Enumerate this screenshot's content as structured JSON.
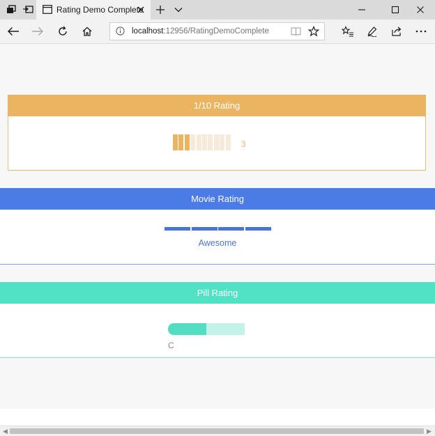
{
  "browser": {
    "tab_title": "Rating Demo Complete",
    "url_host": "localhost",
    "url_path": ":12956/RatingDemoComplete"
  },
  "panels": {
    "ten_rating": {
      "title": "1/10 Rating",
      "value_text": "3",
      "rating": 3,
      "max": 10,
      "color": "#ebb461"
    },
    "movie_rating": {
      "title": "Movie Rating",
      "label": "Awesome",
      "segments_filled": 4,
      "segments_total": 4,
      "color": "#4873d7"
    },
    "pill_rating": {
      "title": "Pill Rating",
      "label": "C",
      "segments_filled": 1,
      "segments_total": 2,
      "color": "#51dec3"
    }
  }
}
